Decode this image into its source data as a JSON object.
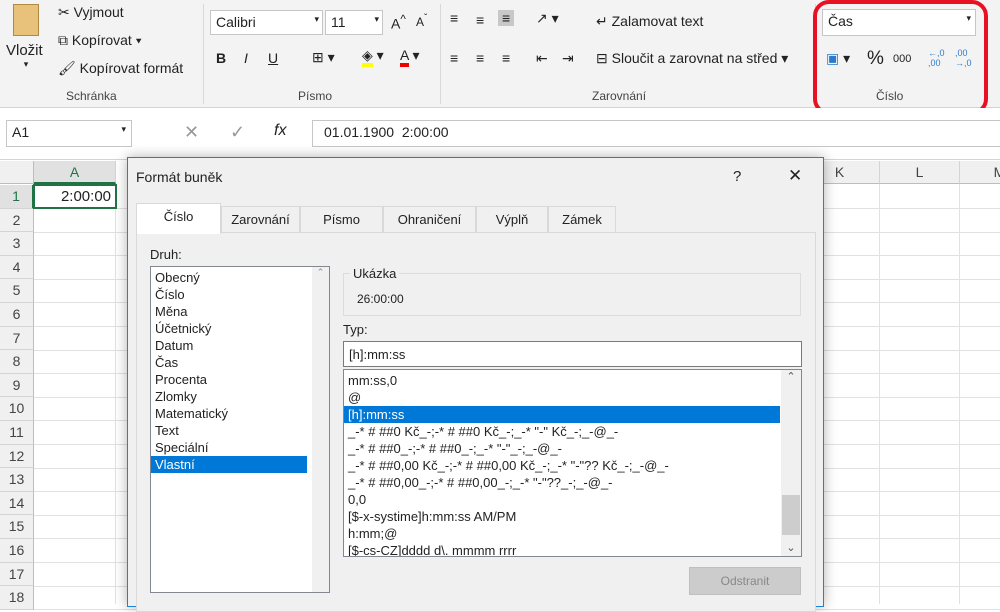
{
  "ribbon": {
    "clipboard": {
      "paste": "Vložit",
      "cut": "Vyjmout",
      "copy": "Kopírovat",
      "format_painter": "Kopírovat formát",
      "label": "Schránka"
    },
    "font": {
      "name": "Calibri",
      "size": "11",
      "bold": "B",
      "italic": "I",
      "underline": "U",
      "label": "Písmo"
    },
    "alignment": {
      "wrap": "Zalamovat text",
      "merge": "Sloučit a zarovnat na střed",
      "label": "Zarovnání"
    },
    "number": {
      "format": "Čas",
      "percent": "%",
      "thousands": "000",
      "inc_dec": "←,0 ,00",
      "dec_dec": ",00 →,0",
      "label": "Číslo",
      "highlight_color": "#e81123"
    }
  },
  "formula_bar": {
    "name_box": "A1",
    "fx": "fx",
    "value": "01.01.1900  2:00:00"
  },
  "sheet": {
    "columns": [
      "A",
      "K",
      "L",
      "M"
    ],
    "rows": [
      "1",
      "2",
      "3",
      "4",
      "5",
      "6",
      "7",
      "8",
      "9",
      "10",
      "11",
      "12",
      "13",
      "14",
      "15",
      "16",
      "17",
      "18"
    ],
    "a1": "2:00:00"
  },
  "dialog": {
    "title": "Formát buněk",
    "help": "?",
    "close": "✕",
    "tabs": [
      "Číslo",
      "Zarovnání",
      "Písmo",
      "Ohraničení",
      "Výplň",
      "Zámek"
    ],
    "category_label": "Druh:",
    "categories": [
      "Obecný",
      "Číslo",
      "Měna",
      "Účetnický",
      "Datum",
      "Čas",
      "Procenta",
      "Zlomky",
      "Matematický",
      "Text",
      "Speciální",
      "Vlastní"
    ],
    "selected_category": "Vlastní",
    "sample_label": "Ukázka",
    "sample_value": "26:00:00",
    "type_label": "Typ:",
    "type_value": "[h]:mm:ss",
    "types": [
      "mm:ss,0",
      "@",
      "[h]:mm:ss",
      "_-* # ##0 Kč_-;-* # ##0 Kč_-;_-* \"-\" Kč_-;_-@_-",
      "_-* # ##0_-;-* # ##0_-;_-* \"-\"_-;_-@_-",
      "_-* # ##0,00 Kč_-;-* # ##0,00 Kč_-;_-* \"-\"?? Kč_-;_-@_-",
      "_-* # ##0,00_-;-* # ##0,00_-;_-* \"-\"??_-;_-@_-",
      "0,0",
      "[$-x-systime]h:mm:ss AM/PM",
      "h:mm;@",
      "[$-cs-CZ]dddd d\\. mmmm rrrr"
    ],
    "selected_type": "[h]:mm:ss",
    "delete": "Odstranit"
  }
}
